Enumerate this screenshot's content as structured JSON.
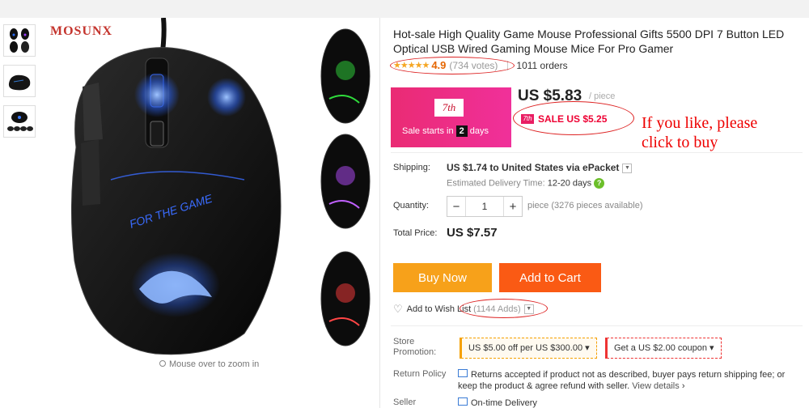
{
  "brand_logo": "MOSUNX",
  "zoom_hint": "Mouse over to zoom in",
  "product": {
    "title": "Hot-sale High Quality Game Mouse Professional Gifts 5500 DPI 7 Button LED Optical USB Wired Gaming Mouse Mice For Pro Gamer",
    "stars": "★★★★★",
    "rating": "4.9",
    "votes": "(734 votes)",
    "orders": "1011 orders"
  },
  "promo": {
    "logo": "7th",
    "starts_prefix": "Sale starts in",
    "days_num": "2",
    "days_label": "days"
  },
  "price": {
    "value": "US $5.83",
    "per": "/ piece",
    "sale_icon": "7th",
    "sale": "SALE US $5.25"
  },
  "annotation": {
    "line1": "If you like, please",
    "line2": "click to buy"
  },
  "shipping": {
    "label": "Shipping:",
    "value": "US $1.74 to United States via ePacket",
    "eta_label": "Estimated Delivery Time:",
    "eta_value": "12-20 days"
  },
  "quantity": {
    "label": "Quantity:",
    "minus": "−",
    "value": "1",
    "plus": "+",
    "note": "piece (3276 pieces available)"
  },
  "total": {
    "label": "Total Price:",
    "value": "US $7.57"
  },
  "actions": {
    "buy_now": "Buy Now",
    "add_to_cart": "Add to Cart",
    "wishlist": "Add to Wish List",
    "wishlist_count": "(1144 Adds)"
  },
  "store_promotion": {
    "label": "Store Promotion:",
    "coupon1": "US $5.00 off per US $300.00",
    "coupon2": "Get a US $2.00 coupon"
  },
  "return_policy": {
    "label": "Return Policy",
    "text": "Returns accepted if product not as described, buyer pays return shipping fee; or keep the product & agree refund with seller.",
    "link": "View details"
  },
  "seller": {
    "label": "Seller",
    "value": "On-time Delivery"
  },
  "colors": {
    "buy": "#f7a11a",
    "cart": "#fa5a14",
    "promo": "#ea2b74",
    "sale": "#ee0033"
  }
}
